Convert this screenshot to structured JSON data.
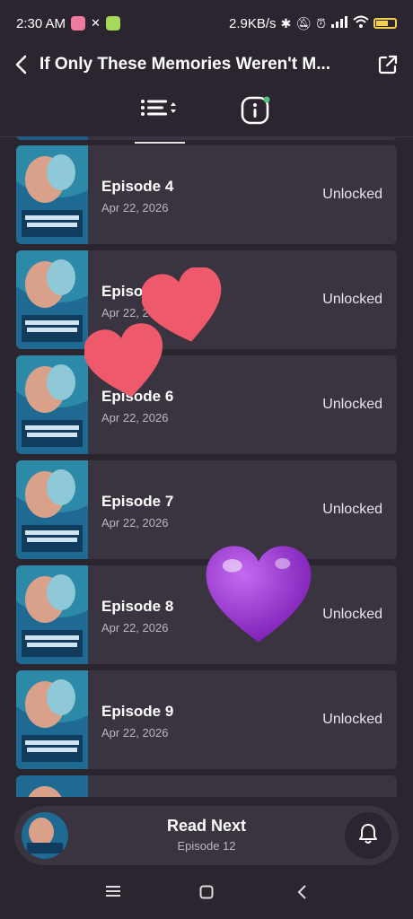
{
  "status_bar": {
    "time": "2:30 AM",
    "network_speed": "2.9KB/s",
    "battery": "6"
  },
  "header": {
    "title": "If Only These Memories Weren't M...",
    "back_icon": "chevron-left-icon",
    "share_icon": "open-external-icon"
  },
  "tabs": [
    {
      "icon": "episode-list-sort-icon",
      "active": true
    },
    {
      "icon": "info-icon",
      "active": false
    }
  ],
  "episodes": [
    {
      "name": "Episode 4",
      "date": "Apr 22, 2026",
      "status": "Unlocked"
    },
    {
      "name": "Episode 5",
      "date": "Apr 22, 2026",
      "status": "Unlocked"
    },
    {
      "name": "Episode 6",
      "date": "Apr 22, 2026",
      "status": "Unlocked"
    },
    {
      "name": "Episode 7",
      "date": "Apr 22, 2026",
      "status": "Unlocked"
    },
    {
      "name": "Episode 8",
      "date": "Apr 22, 2026",
      "status": "Unlocked"
    },
    {
      "name": "Episode 9",
      "date": "Apr 22, 2026",
      "status": "Unlocked"
    }
  ],
  "read_next": {
    "label": "Read Next",
    "episode": "Episode 12"
  },
  "colors": {
    "background": "#2b2530",
    "card": "#3a3440",
    "heart_red": "#ee5a6b",
    "heart_purple": "#9b30d9"
  }
}
